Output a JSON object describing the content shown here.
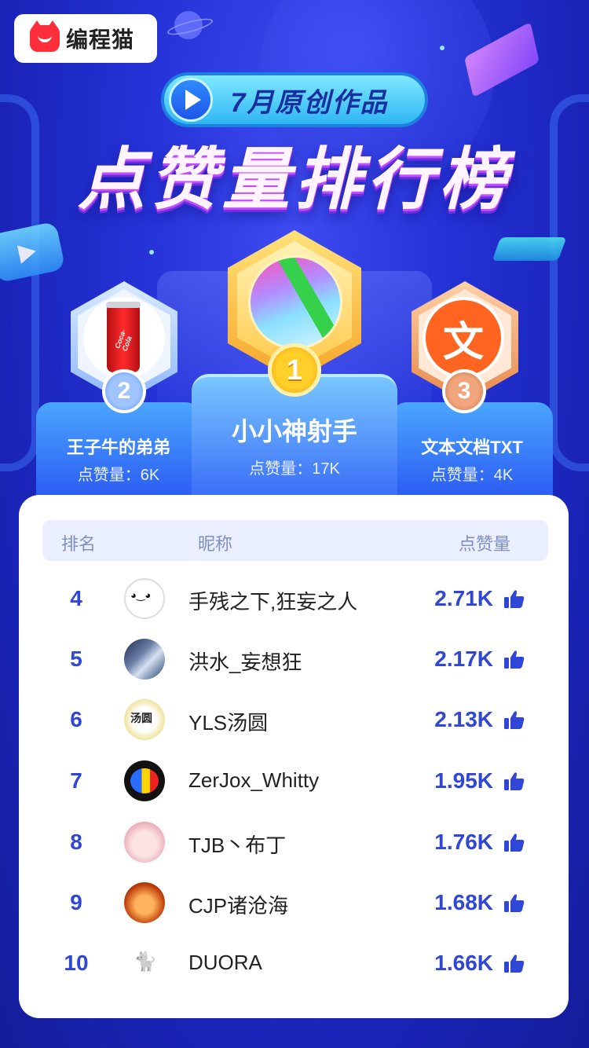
{
  "brand": {
    "name": "编程猫",
    "logo_icon": "cat-logo-icon"
  },
  "header": {
    "subtitle": "7月原创作品",
    "title": "点赞量排行榜"
  },
  "podium": [
    {
      "rank": "1",
      "name": "小小神射手",
      "likes_label": "点赞量：17K"
    },
    {
      "rank": "2",
      "name": "王子牛的弟弟",
      "likes_label": "点赞量：6K"
    },
    {
      "rank": "3",
      "name": "文本文档TXT",
      "likes_label": "点赞量：4K",
      "avatar_char": "文"
    }
  ],
  "podium_misc": {
    "coke_text": "Coca-Cola"
  },
  "list": {
    "headers": {
      "rank": "排名",
      "nickname": "昵称",
      "likes": "点赞量"
    },
    "rows": [
      {
        "rank": "4",
        "name": "手残之下,狂妄之人",
        "likes": "2.71K"
      },
      {
        "rank": "5",
        "name": "洪水_妄想狂",
        "likes": "2.17K"
      },
      {
        "rank": "6",
        "name": "YLS汤圆",
        "likes": "2.13K"
      },
      {
        "rank": "7",
        "name": "ZerJox_Whitty",
        "likes": "1.95K"
      },
      {
        "rank": "8",
        "name": "TJB丶布丁",
        "likes": "1.76K"
      },
      {
        "rank": "9",
        "name": "CJP诸沧海",
        "likes": "1.68K"
      },
      {
        "rank": "10",
        "name": "DUORA",
        "likes": "1.66K"
      }
    ]
  },
  "colors": {
    "accent": "#2f46d6",
    "gold": "#f7a52a",
    "silver": "#8db7ff",
    "bronze": "#e8874a"
  }
}
